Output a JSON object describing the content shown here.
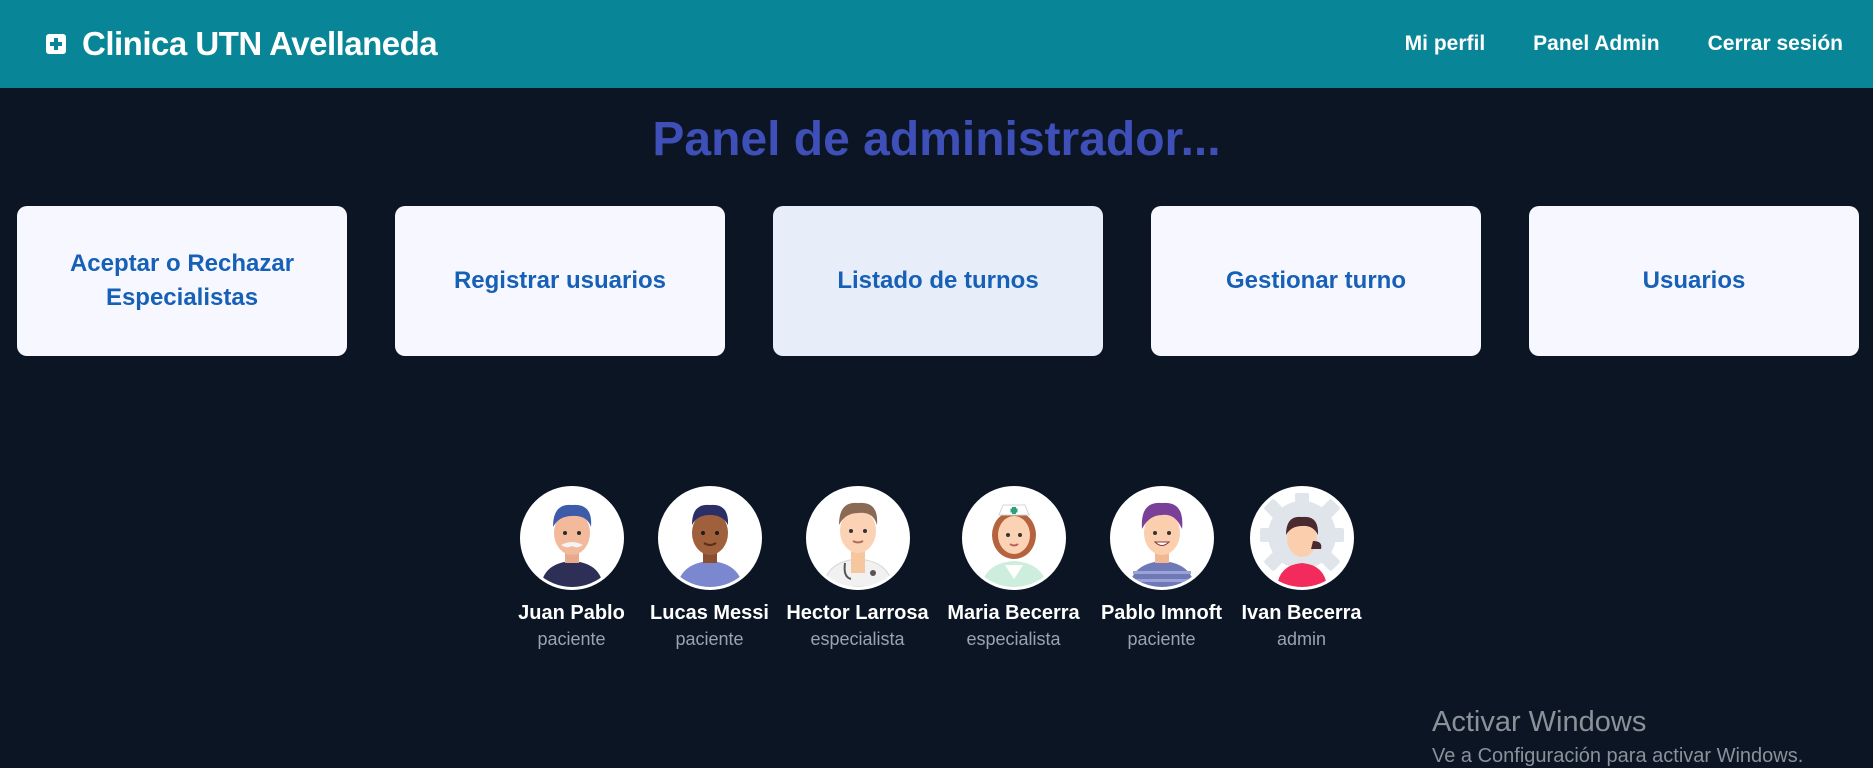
{
  "navbar": {
    "brand": "Clinica UTN Avellaneda",
    "links": [
      "Mi perfil",
      "Panel Admin",
      "Cerrar sesión"
    ]
  },
  "panel": {
    "title": "Panel de administrador...",
    "cards": [
      "Aceptar o Rechazar Especialistas",
      "Registrar usuarios",
      "Listado de turnos",
      "Gestionar turno",
      "Usuarios"
    ],
    "active_card": "Listado de turnos"
  },
  "users": [
    {
      "name": "Juan Pablo",
      "role": "paciente",
      "avatar": "man-mustache-avatar"
    },
    {
      "name": "Lucas Messi",
      "role": "paciente",
      "avatar": "man-dark-skin-avatar"
    },
    {
      "name": "Hector Larrosa",
      "role": "especialista",
      "avatar": "doctor-avatar"
    },
    {
      "name": "Maria Becerra",
      "role": "especialista",
      "avatar": "nurse-avatar"
    },
    {
      "name": "Pablo Imnoft",
      "role": "paciente",
      "avatar": "man-purple-hair-avatar"
    },
    {
      "name": "Ivan Becerra",
      "role": "admin",
      "avatar": "admin-gear-avatar"
    }
  ],
  "watermark": {
    "title": "Activar Windows",
    "subtitle": "Ve a Configuración para activar Windows."
  },
  "colors": {
    "navbar": "#088596",
    "background": "#0b1524",
    "title": "#3f4fb8",
    "card_text": "#1660b8"
  }
}
